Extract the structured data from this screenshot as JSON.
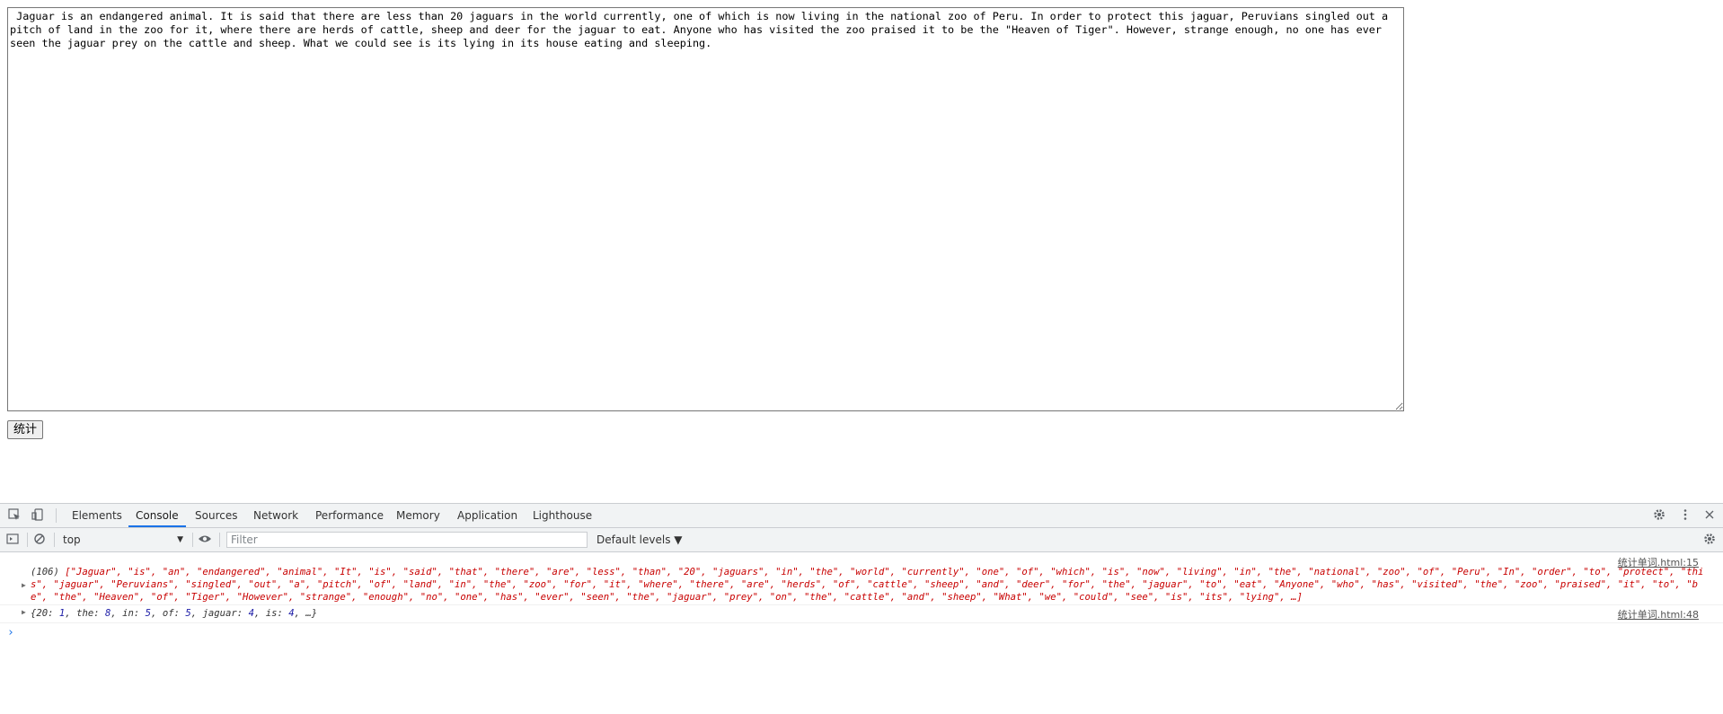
{
  "textarea": {
    "value": " Jaguar is an endangered animal. It is said that there are less than 20 jaguars in the world currently, one of which is now living in the national zoo of Peru. In order to protect this jaguar, Peruvians singled out a pitch of land in the zoo for it, where there are herds of cattle, sheep and deer for the jaguar to eat. Anyone who has visited the zoo praised it to be the \"Heaven of Tiger\". However, strange enough, no one has ever seen the jaguar prey on the cattle and sheep. What we could see is its lying in its house eating and sleeping."
  },
  "button": {
    "label": "统计"
  },
  "devtools": {
    "tabs": [
      "Elements",
      "Console",
      "Sources",
      "Network",
      "Performance",
      "Memory",
      "Application",
      "Lighthouse"
    ],
    "active_tab": "Console",
    "icons": {
      "inspect": "inspect-element-icon",
      "device": "device-toolbar-icon",
      "settings": "gear-icon",
      "more": "more-vertical-icon",
      "close": "close-icon",
      "sidebar": "console-sidebar-icon",
      "clear": "clear-console-icon",
      "eye": "eye-icon",
      "console_settings": "gear-icon"
    },
    "toolbar": {
      "context": "top",
      "filter_placeholder": "Filter",
      "levels": "Default levels ▼"
    },
    "messages": [
      {
        "source": "统计单词.html:15",
        "count": "(106)",
        "text": " [\"Jaguar\", \"is\", \"an\", \"endangered\", \"animal\", \"It\", \"is\", \"said\", \"that\", \"there\", \"are\", \"less\", \"than\", \"20\", \"jaguars\", \"in\", \"the\", \"world\", \"currently\", \"one\", \"of\", \"which\", \"is\", \"now\", \"living\", \"in\", \"the\", \"national\", \"zoo\", \"of\", \"Peru\", \"In\", \"order\", \"to\", \"protect\", \"this\", \"jaguar\", \"Peruvians\", \"singled\", \"out\", \"a\", \"pitch\", \"of\", \"land\", \"in\", \"the\", \"zoo\", \"for\", \"it\", \"where\", \"there\", \"are\", \"herds\", \"of\", \"cattle\", \"sheep\", \"and\", \"deer\", \"for\", \"the\", \"jaguar\", \"to\", \"eat\", \"Anyone\", \"who\", \"has\", \"visited\", \"the\", \"zoo\", \"praised\", \"it\", \"to\", \"be\", \"the\", \"Heaven\", \"of\", \"Tiger\", \"However\", \"strange\", \"enough\", \"no\", \"one\", \"has\", \"ever\", \"seen\", \"the\", \"jaguar\", \"prey\", \"on\", \"the\", \"cattle\", \"and\", \"sheep\", \"What\", \"we\", \"could\", \"see\", \"is\", \"its\", \"lying\", …]"
      },
      {
        "source": "统计单词.html:48",
        "entries": [
          {
            "key": "20",
            "value": "1"
          },
          {
            "key": "the",
            "value": "8"
          },
          {
            "key": "in",
            "value": "5"
          },
          {
            "key": "of",
            "value": "5"
          },
          {
            "key": "jaguar",
            "value": "4"
          },
          {
            "key": "is",
            "value": "4"
          }
        ],
        "ellipsis": "…"
      }
    ],
    "prompt": "›"
  }
}
